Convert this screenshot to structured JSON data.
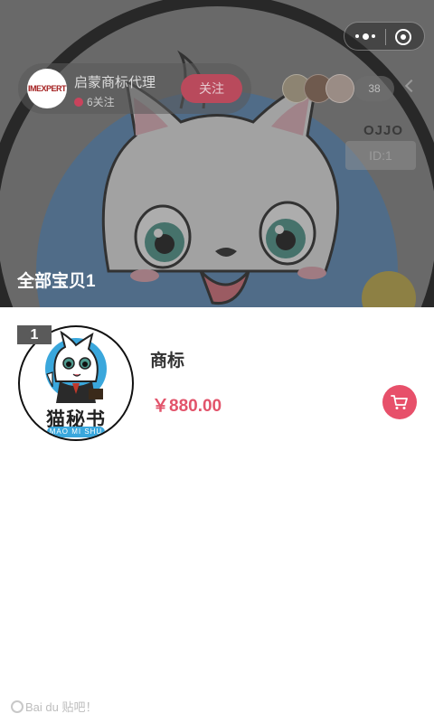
{
  "capsule": {
    "more_icon": "more-dots-icon",
    "close_icon": "target-circle-icon"
  },
  "shop": {
    "logo_text": "IMEXPERT",
    "name": "启蒙商标代理",
    "follow_count": "6关注",
    "follow_label": "关注",
    "fans_count": "38",
    "nickname": "OJJO",
    "id": "ID:1"
  },
  "section": {
    "all_items_label": "全部宝贝1"
  },
  "products": [
    {
      "rank": "1",
      "title": "商标",
      "price": "￥880.00",
      "thumb_brand": "猫秘书",
      "thumb_sub": "MAO MI SHU",
      "cart_icon": "cart-icon"
    }
  ],
  "watermark": {
    "text": "Bai du 贴吧！"
  },
  "colors": {
    "accent": "#e7506a",
    "price": "#e2546b",
    "rank_bg": "#5a5a5a"
  }
}
